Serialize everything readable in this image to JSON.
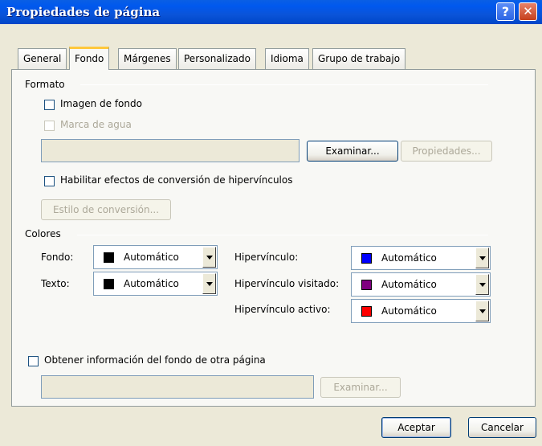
{
  "window": {
    "title": "Propiedades de página",
    "help_glyph": "?",
    "close_glyph": "✕"
  },
  "tabs": [
    {
      "label": "General"
    },
    {
      "label": "Fondo"
    },
    {
      "label": "Márgenes"
    },
    {
      "label": "Personalizado"
    },
    {
      "label": "Idioma"
    },
    {
      "label": "Grupo de trabajo"
    }
  ],
  "formato": {
    "heading": "Formato",
    "imagen_fondo": "Imagen de fondo",
    "marca_agua": "Marca de agua",
    "examinar": "Examinar...",
    "propiedades": "Propiedades...",
    "habilitar": "Habilitar efectos de conversión de hipervínculos",
    "estilo": "Estilo de conversión..."
  },
  "colores": {
    "heading": "Colores",
    "fondo_label": "Fondo:",
    "texto_label": "Texto:",
    "hiper_label": "Hipervínculo:",
    "hiper_visitado_label": "Hipervínculo visitado:",
    "hiper_activo_label": "Hipervínculo activo:",
    "fondo": {
      "value": "Automático",
      "color": "#000000"
    },
    "texto": {
      "value": "Automático",
      "color": "#000000"
    },
    "hiper": {
      "value": "Automático",
      "color": "#0000FF"
    },
    "hiper_visitado": {
      "value": "Automático",
      "color": "#800080"
    },
    "hiper_activo": {
      "value": "Automático",
      "color": "#FF0000"
    }
  },
  "obtener": {
    "label": "Obtener información del fondo de otra página",
    "examinar": "Examinar..."
  },
  "footer": {
    "aceptar": "Aceptar",
    "cancelar": "Cancelar"
  }
}
